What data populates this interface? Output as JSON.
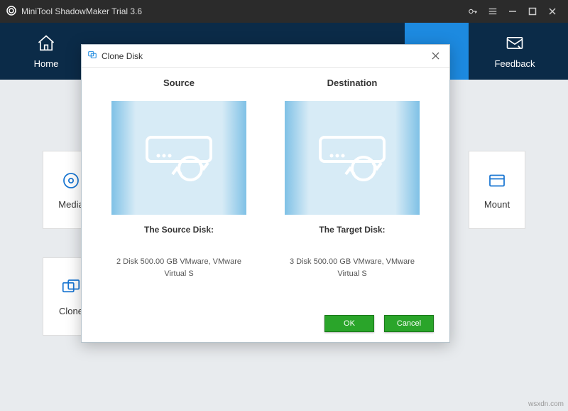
{
  "titlebar": {
    "app_name": "MiniTool ShadowMaker Trial 3.6"
  },
  "header": {
    "home_label": "Home",
    "feedback_label": "Feedback"
  },
  "bg_cards": {
    "media_label": "Media",
    "mount_label": "Mount",
    "clone_label": "Clone"
  },
  "dialog": {
    "title": "Clone Disk",
    "source_head": "Source",
    "destination_head": "Destination",
    "source_label": "The Source Disk:",
    "target_label": "The Target Disk:",
    "source_desc": "2 Disk 500.00 GB VMware, VMware Virtual S",
    "target_desc": "3 Disk 500.00 GB VMware, VMware Virtual S",
    "ok_label": "OK",
    "cancel_label": "Cancel"
  },
  "watermark": "wsxdn.com"
}
